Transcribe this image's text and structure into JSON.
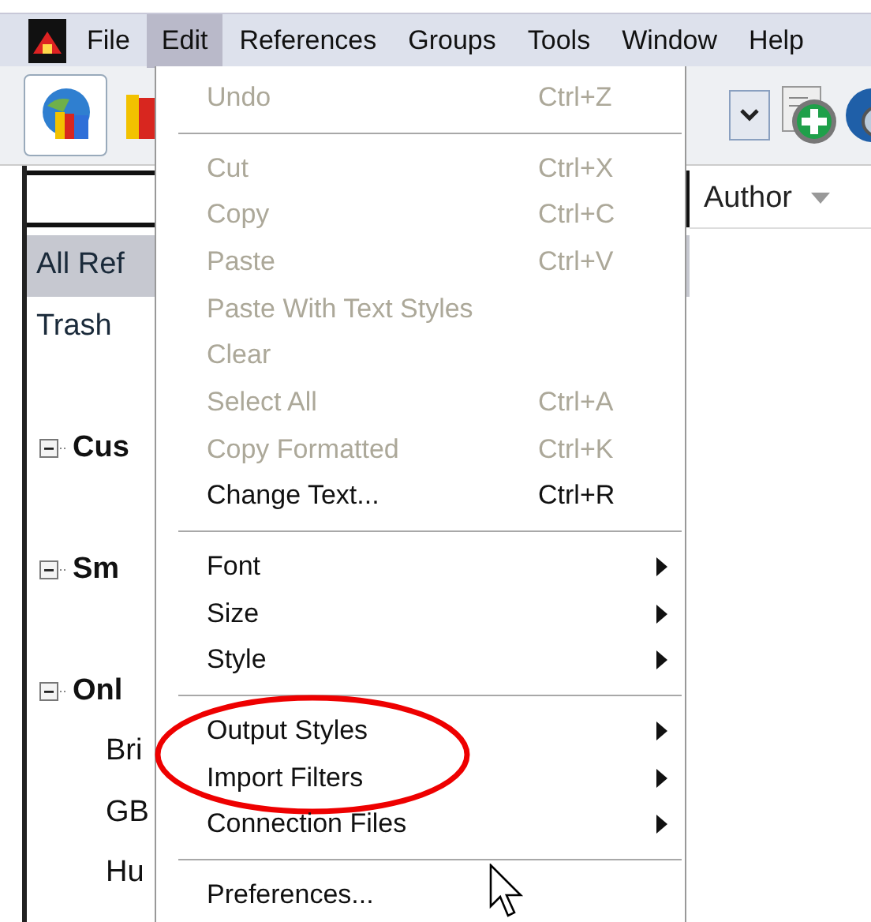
{
  "menubar": {
    "items": [
      {
        "label": "File",
        "selected": false
      },
      {
        "label": "Edit",
        "selected": true
      },
      {
        "label": "References",
        "selected": false
      },
      {
        "label": "Groups",
        "selected": false
      },
      {
        "label": "Tools",
        "selected": false
      },
      {
        "label": "Window",
        "selected": false
      },
      {
        "label": "Help",
        "selected": false
      }
    ]
  },
  "edit_menu": {
    "sections": [
      [
        {
          "label": "Undo",
          "shortcut": "Ctrl+Z",
          "disabled": true
        }
      ],
      [
        {
          "label": "Cut",
          "shortcut": "Ctrl+X",
          "disabled": true
        },
        {
          "label": "Copy",
          "shortcut": "Ctrl+C",
          "disabled": true
        },
        {
          "label": "Paste",
          "shortcut": "Ctrl+V",
          "disabled": true
        },
        {
          "label": "Paste With Text Styles",
          "disabled": true
        },
        {
          "label": "Clear",
          "disabled": true
        },
        {
          "label": "Select All",
          "shortcut": "Ctrl+A",
          "disabled": true
        },
        {
          "label": "Copy Formatted",
          "shortcut": "Ctrl+K",
          "disabled": true
        },
        {
          "label": "Change Text...",
          "shortcut": "Ctrl+R",
          "disabled": false
        }
      ],
      [
        {
          "label": "Font",
          "disabled": false,
          "submenu": true
        },
        {
          "label": "Size",
          "disabled": false,
          "submenu": true
        },
        {
          "label": "Style",
          "disabled": false,
          "submenu": true
        }
      ],
      [
        {
          "label": "Output Styles",
          "disabled": false,
          "submenu": true,
          "circled": true
        },
        {
          "label": "Import Filters",
          "disabled": false,
          "submenu": true,
          "circled": true
        },
        {
          "label": "Connection Files",
          "disabled": false,
          "submenu": true
        }
      ],
      [
        {
          "label": "Preferences...",
          "disabled": false
        }
      ]
    ]
  },
  "reference_table": {
    "columns": [
      {
        "label": "Author",
        "sorted": true
      }
    ]
  },
  "sidebar": {
    "items": [
      {
        "label": "All Ref",
        "selected": true
      },
      {
        "label": "Trash",
        "selected": false
      }
    ],
    "groups": [
      {
        "label": "Cus",
        "expanded": true
      },
      {
        "label": "Sm",
        "expanded": true
      },
      {
        "label": "Onl",
        "expanded": true,
        "children": [
          {
            "label": "Bri"
          },
          {
            "label": "GB"
          },
          {
            "label": "Hu"
          }
        ]
      }
    ]
  }
}
